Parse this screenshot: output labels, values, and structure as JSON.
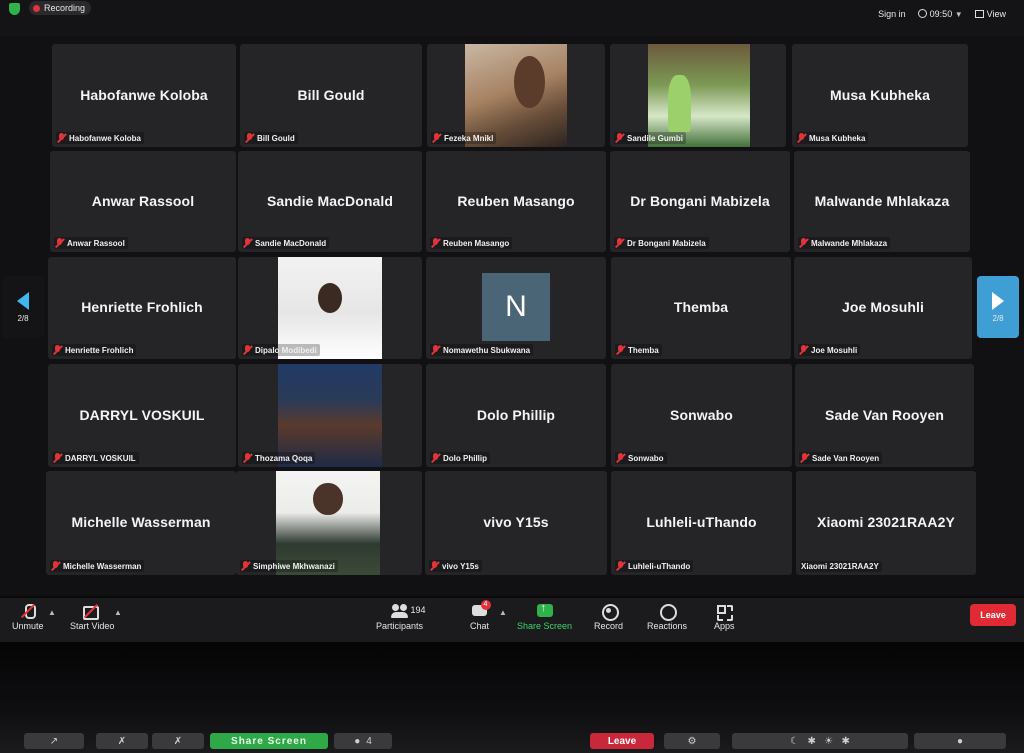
{
  "status_bar": {
    "recording_label": "Recording",
    "sign_in": "Sign in",
    "time": "09:50",
    "view_label": "View"
  },
  "pagination": {
    "left_label": "2/8",
    "right_label": "2/8"
  },
  "participants": [
    {
      "name": "Habofanwe Koloba",
      "label": "Habofanwe Koloba",
      "video": false
    },
    {
      "name": "Bill Gould",
      "label": "Bill Gould",
      "video": false
    },
    {
      "name": "",
      "label": "Fezeka Mnikl",
      "video": true,
      "photo": "fezeka"
    },
    {
      "name": "",
      "label": "Sandile Gumbi",
      "video": true,
      "photo": "sandile"
    },
    {
      "name": "Musa Kubheka",
      "label": "Musa Kubheka",
      "video": false
    },
    {
      "name": "Anwar Rassool",
      "label": "Anwar Rassool",
      "video": false
    },
    {
      "name": "Sandie MacDonald",
      "label": "Sandie MacDonald",
      "video": false
    },
    {
      "name": "Reuben Masango",
      "label": "Reuben Masango",
      "video": false
    },
    {
      "name": "Dr Bongani Mabizela",
      "label": "Dr Bongani Mabizela",
      "video": false
    },
    {
      "name": "Malwande Mhlakaza",
      "label": "Malwande Mhlakaza",
      "video": false
    },
    {
      "name": "Henriette Frohlich",
      "label": "Henriette Frohlich",
      "video": false
    },
    {
      "name": "",
      "label": "Dipalo Modibedi",
      "video": true,
      "photo": "dipalo"
    },
    {
      "name": "",
      "label": "Nomawethu Sbukwana",
      "video": false,
      "avatar": "N"
    },
    {
      "name": "Themba",
      "label": "Themba",
      "video": false
    },
    {
      "name": "Joe Mosuhli",
      "label": "Joe Mosuhli",
      "video": false
    },
    {
      "name": "DARRYL VOSKUIL",
      "label": "DARRYL VOSKUIL",
      "video": false
    },
    {
      "name": "",
      "label": "Thozama Qoqa",
      "video": true,
      "photo": "thozama"
    },
    {
      "name": "Dolo Phillip",
      "label": "Dolo Phillip",
      "video": false
    },
    {
      "name": "Sonwabo",
      "label": "Sonwabo",
      "video": false
    },
    {
      "name": "Sade Van Rooyen",
      "label": "Sade Van Rooyen",
      "video": false
    },
    {
      "name": "Michelle Wasserman",
      "label": "Michelle Wasserman",
      "video": false
    },
    {
      "name": "",
      "label": "Simphiwe Mkhwanazi",
      "video": true,
      "photo": "simphiwe"
    },
    {
      "name": "vivo Y15s",
      "label": "vivo Y15s",
      "video": false
    },
    {
      "name": "Luhleli-uThando",
      "label": "Luhleli-uThando",
      "video": false
    },
    {
      "name": "Xiaomi 23021RAA2Y",
      "label": "Xiaomi 23021RAA2Y",
      "video": false,
      "unmuted": true
    }
  ],
  "toolbar": {
    "unmute": "Unmute",
    "start_video": "Start Video",
    "participants_label": "Participants",
    "participants_count": "194",
    "chat_label": "Chat",
    "chat_badge": "4",
    "share_screen": "Share Screen",
    "record": "Record",
    "reactions": "Reactions",
    "apps": "Apps",
    "leave": "Leave"
  },
  "reflection": {
    "share_screen": "Share Screen",
    "chat_count": "4",
    "leave": "Leave"
  },
  "colors": {
    "tile_bg": "#252527",
    "muted_red": "#e0343b",
    "share_green": "#2fb24a",
    "leave_red": "#e02b35",
    "page_next_blue": "#3f9fd4"
  }
}
